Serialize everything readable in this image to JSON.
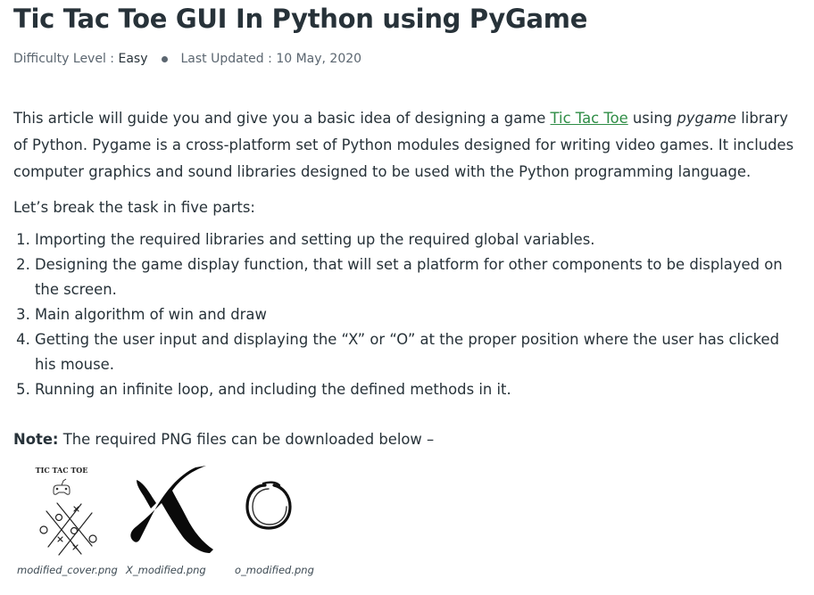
{
  "article": {
    "title": "Tic Tac Toe GUI In Python using PyGame",
    "meta": {
      "difficulty_label": "Difficulty Level :",
      "difficulty_value": "Easy",
      "updated_label": "Last Updated :",
      "updated_value": "10 May, 2020"
    },
    "intro": {
      "part1": "This article will guide you and give you a basic idea of designing a game ",
      "link_text": "Tic Tac Toe",
      "part2": " using ",
      "emphasis": "pygame",
      "part3": " library of Python. Pygame is a cross-platform set of Python modules designed for writing video games. It includes computer graphics and sound libraries designed to be used with the Python programming language."
    },
    "lead": "Let’s break the task in five parts:",
    "steps": [
      "Importing the required libraries and setting up the required global variables.",
      "Designing the game display function, that will set a platform for other components to be displayed on the screen.",
      "Main algorithm of win and draw",
      "Getting the user input and displaying the “X” or “O” at the proper position where the user has clicked his mouse.",
      "Running an infinite loop, and including the defined methods in it."
    ],
    "note": {
      "label": "Note:",
      "text": " The required PNG files can be downloaded below –"
    },
    "images": [
      {
        "caption": "modified_cover.png",
        "cover_text": "TIC TAC TOE"
      },
      {
        "caption": "X_modified.png"
      },
      {
        "caption": "o_modified.png"
      }
    ],
    "colors": {
      "text": "#273239",
      "link": "#2f8d46",
      "meta": "#5b6670"
    }
  }
}
